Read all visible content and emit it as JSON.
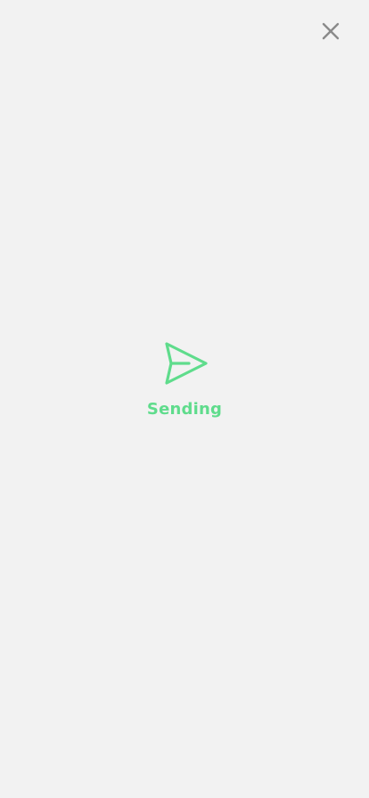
{
  "colors": {
    "background": "#f2f2f2",
    "accent": "#5fdc8c",
    "close_icon": "#8a8a8a"
  },
  "header": {
    "close_icon": "close-icon"
  },
  "status": {
    "icon": "send-icon",
    "text": "Sending"
  }
}
